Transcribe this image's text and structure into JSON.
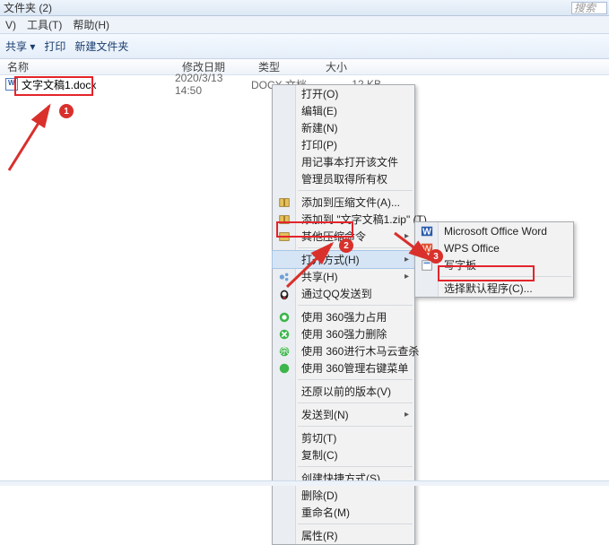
{
  "title": "文件夹 (2)",
  "search_placeholder": "搜索",
  "menubar": {
    "v": "V)",
    "tools": "工具(T)",
    "help": "帮助(H)"
  },
  "toolbar": {
    "share": "共享 ▾",
    "print": "打印",
    "newfolder": "新建文件夹"
  },
  "columns": {
    "name": "名称",
    "date": "修改日期",
    "type": "类型",
    "size": "大小"
  },
  "file": {
    "name": "文字文稿1.docx",
    "date": "2020/3/13 14:50",
    "type": "DOCX 文档",
    "size": "12 KB"
  },
  "steps": {
    "s1": "1",
    "s2": "2",
    "s3": "3"
  },
  "ctx": {
    "open": "打开(O)",
    "edit": "编辑(E)",
    "new": "新建(N)",
    "print": "打印(P)",
    "notepad": "用记事本打开该文件",
    "admin": "管理员取得所有权",
    "addarch": "添加到压缩文件(A)...",
    "addzip": "添加到 \"文字文稿1.zip\" (T)",
    "otherzip": "其他压缩命令",
    "openwith": "打开方式(H)",
    "share": "共享(H)",
    "qqsend": "通过QQ发送到",
    "360occ": "使用 360强力占用",
    "360del": "使用 360强力删除",
    "360cloud": "使用 360进行木马云查杀",
    "360menu": "使用 360管理右键菜单",
    "restore": "还原以前的版本(V)",
    "sendto": "发送到(N)",
    "cut": "剪切(T)",
    "copy": "复制(C)",
    "shortcut": "创建快捷方式(S)",
    "delete": "删除(D)",
    "rename": "重命名(M)",
    "props": "属性(R)"
  },
  "sub": {
    "word": "Microsoft Office Word",
    "wps": "WPS Office",
    "wordpad": "写字板",
    "choose": "选择默认程序(C)..."
  }
}
